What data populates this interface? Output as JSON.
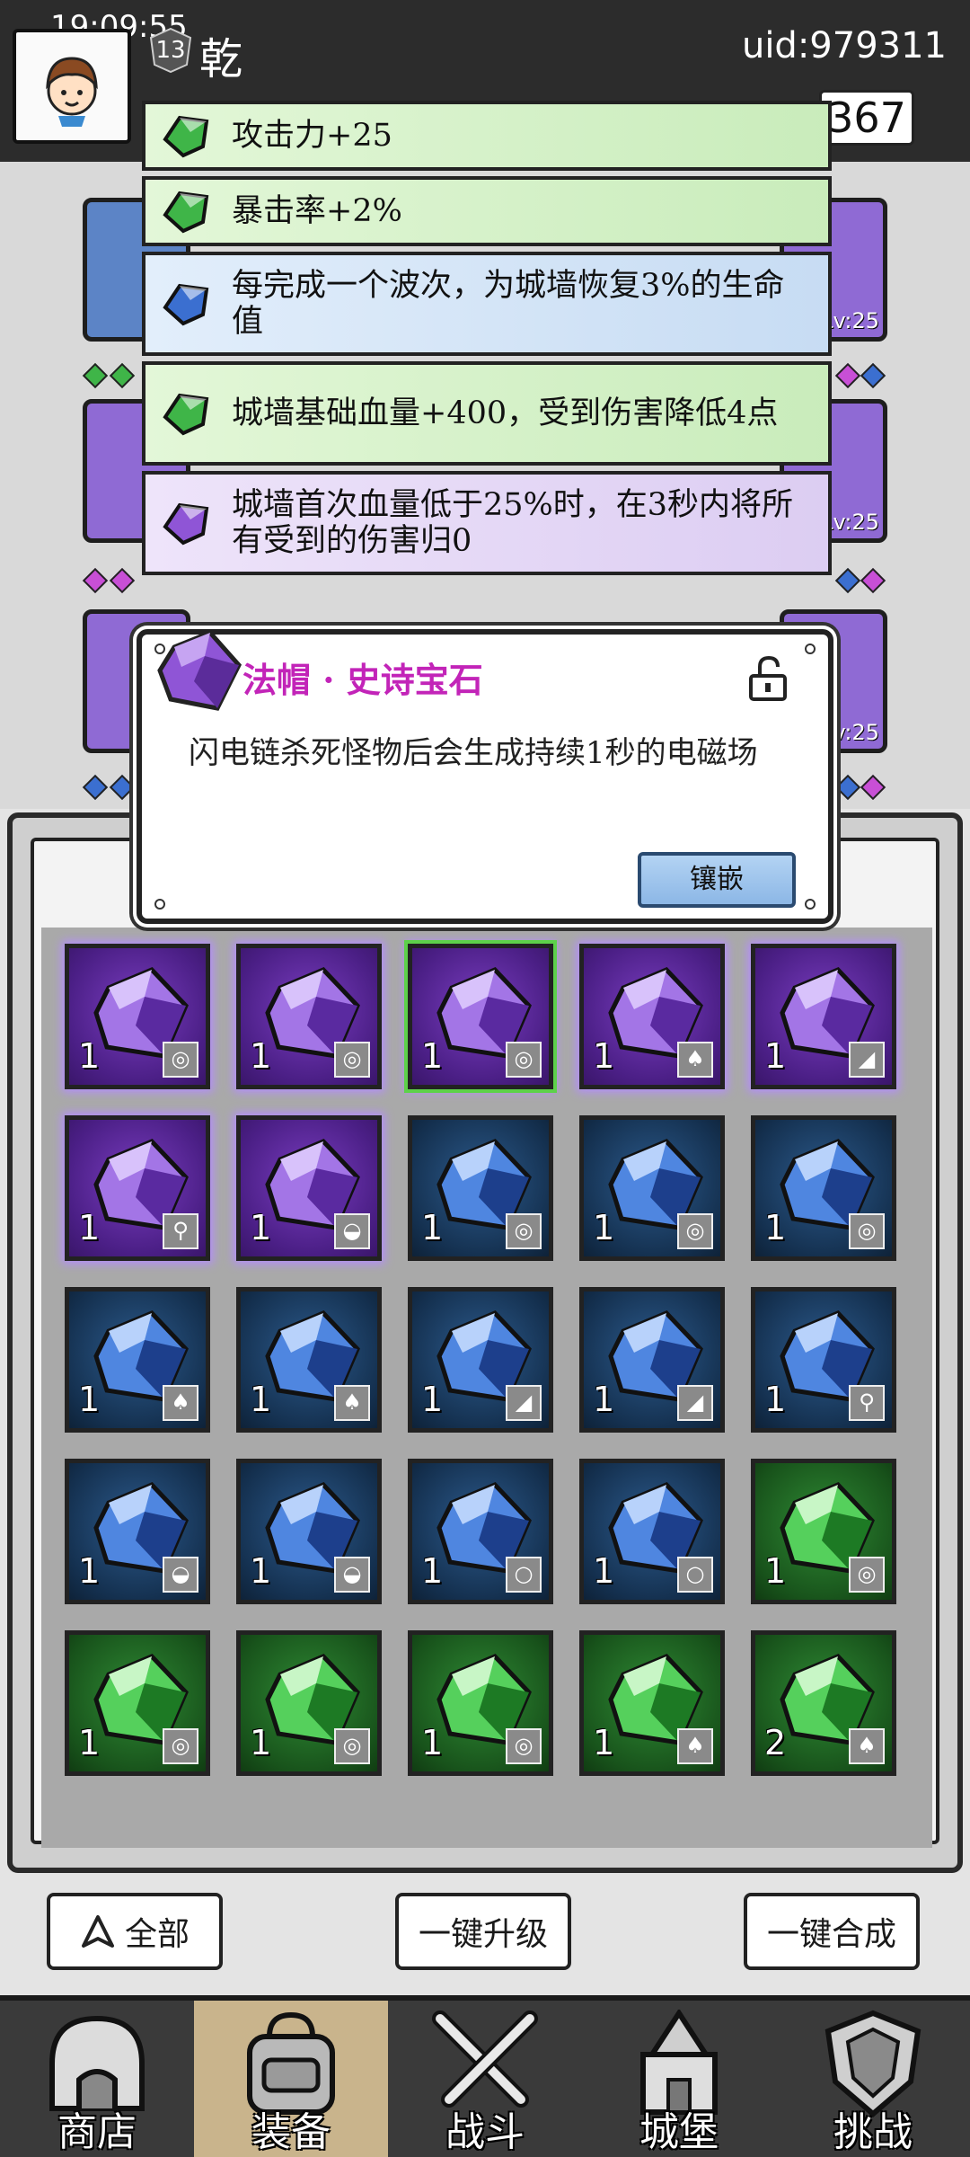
{
  "status_bar": {
    "time": "19:09:55"
  },
  "header": {
    "level": "13",
    "player_name": "乾",
    "uid": "uid:979311",
    "currency_value": "367"
  },
  "attributes": [
    {
      "text": "攻击力+25",
      "color": "green"
    },
    {
      "text": "暴击率+2%",
      "color": "green"
    },
    {
      "text": "每完成一个波次，为城墙恢复3%的生命值",
      "color": "blue"
    },
    {
      "text": "城墙基础血量+400，受到伤害降低4点",
      "color": "green"
    },
    {
      "text": "城墙首次血量低于25%时，在3秒内将所有受到的伤害归0",
      "color": "purple"
    }
  ],
  "equipment_slots": [
    {
      "level": "Lv:25"
    },
    {
      "level": "Lv:25"
    },
    {
      "level": "Lv:25"
    }
  ],
  "popup": {
    "title": "法帽 · 史诗宝石",
    "description": "闪电链杀死怪物后会生成持续1秒的电磁场",
    "inlay_label": "镶嵌",
    "lock_icon": "unlock-icon"
  },
  "gems": [
    {
      "rarity": "purple",
      "count": "1",
      "slot": "ring"
    },
    {
      "rarity": "purple",
      "count": "1",
      "slot": "ring"
    },
    {
      "rarity": "purple",
      "count": "1",
      "slot": "ring",
      "selected": true
    },
    {
      "rarity": "purple",
      "count": "1",
      "slot": "armor"
    },
    {
      "rarity": "purple",
      "count": "1",
      "slot": "boots"
    },
    {
      "rarity": "purple",
      "count": "1",
      "slot": "wand"
    },
    {
      "rarity": "purple",
      "count": "1",
      "slot": "hat"
    },
    {
      "rarity": "blue",
      "count": "1",
      "slot": "ring"
    },
    {
      "rarity": "blue",
      "count": "1",
      "slot": "ring"
    },
    {
      "rarity": "blue",
      "count": "1",
      "slot": "ring"
    },
    {
      "rarity": "blue",
      "count": "1",
      "slot": "armor"
    },
    {
      "rarity": "blue",
      "count": "1",
      "slot": "armor"
    },
    {
      "rarity": "blue",
      "count": "1",
      "slot": "boots"
    },
    {
      "rarity": "blue",
      "count": "1",
      "slot": "boots"
    },
    {
      "rarity": "blue",
      "count": "1",
      "slot": "wand"
    },
    {
      "rarity": "blue",
      "count": "1",
      "slot": "hat"
    },
    {
      "rarity": "blue",
      "count": "1",
      "slot": "hat"
    },
    {
      "rarity": "blue",
      "count": "1",
      "slot": "necklace"
    },
    {
      "rarity": "blue",
      "count": "1",
      "slot": "necklace"
    },
    {
      "rarity": "green",
      "count": "1",
      "slot": "ring"
    },
    {
      "rarity": "green",
      "count": "1",
      "slot": "ring"
    },
    {
      "rarity": "green",
      "count": "1",
      "slot": "ring"
    },
    {
      "rarity": "green",
      "count": "1",
      "slot": "ring"
    },
    {
      "rarity": "green",
      "count": "1",
      "slot": "armor"
    },
    {
      "rarity": "green",
      "count": "2",
      "slot": "armor"
    }
  ],
  "actions": {
    "filter_label": "全部",
    "upgrade_all_label": "一键升级",
    "merge_all_label": "一键合成"
  },
  "nav": [
    {
      "label": "商店",
      "icon": "shop-icon"
    },
    {
      "label": "装备",
      "icon": "backpack-icon",
      "active": true
    },
    {
      "label": "战斗",
      "icon": "crossed-swords-icon"
    },
    {
      "label": "城堡",
      "icon": "castle-icon"
    },
    {
      "label": "挑战",
      "icon": "shield-icon"
    }
  ],
  "colors": {
    "purple_gem": "#8f55d6",
    "blue_gem": "#3b6fd0",
    "green_gem": "#3fb548",
    "popup_title": "#c224b8"
  }
}
